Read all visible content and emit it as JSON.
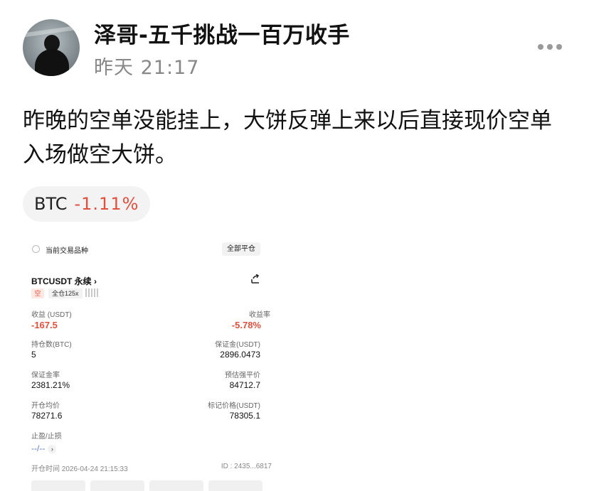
{
  "post": {
    "author": "泽哥-五千挑战一百万收手",
    "time": "昨天 21:17",
    "text": "昨晚的空单没能挂上，大饼反弹上来以后直接现价空单入场做空大饼。",
    "ticker": {
      "symbol": "BTC",
      "change": "-1.11%",
      "change_color": "#e2503d"
    }
  },
  "position": {
    "current_label": "当前交易品种",
    "close_all": "全部平仓",
    "pair": "BTCUSDT 永续",
    "pair_chevron": "›",
    "share_icon": "share-icon",
    "side": "空",
    "leverage": "全仓125x",
    "pnl_label": "收益 (USDT)",
    "pnl_value": "-167.5",
    "roe_label": "收益率",
    "roe_value": "-5.78%",
    "size_label": "持仓数(BTC)",
    "size_value": "5",
    "margin_label": "保证金(USDT)",
    "margin_value": "2896.0473",
    "margin_ratio_label": "保证金率",
    "margin_ratio_value": "2381.21%",
    "liq_label": "预估强平价",
    "liq_value": "84712.7",
    "entry_label": "开仓均价",
    "entry_value": "78271.6",
    "mark_label": "标记价格(USDT)",
    "mark_value": "78305.1",
    "tpsl_label": "止盈/止损",
    "tpsl_value": "--/--",
    "tpsl_chevron": "›",
    "open_time": "开仓时间 2026-04-24 21:15:33",
    "order_id": "ID : 2435...6817"
  }
}
